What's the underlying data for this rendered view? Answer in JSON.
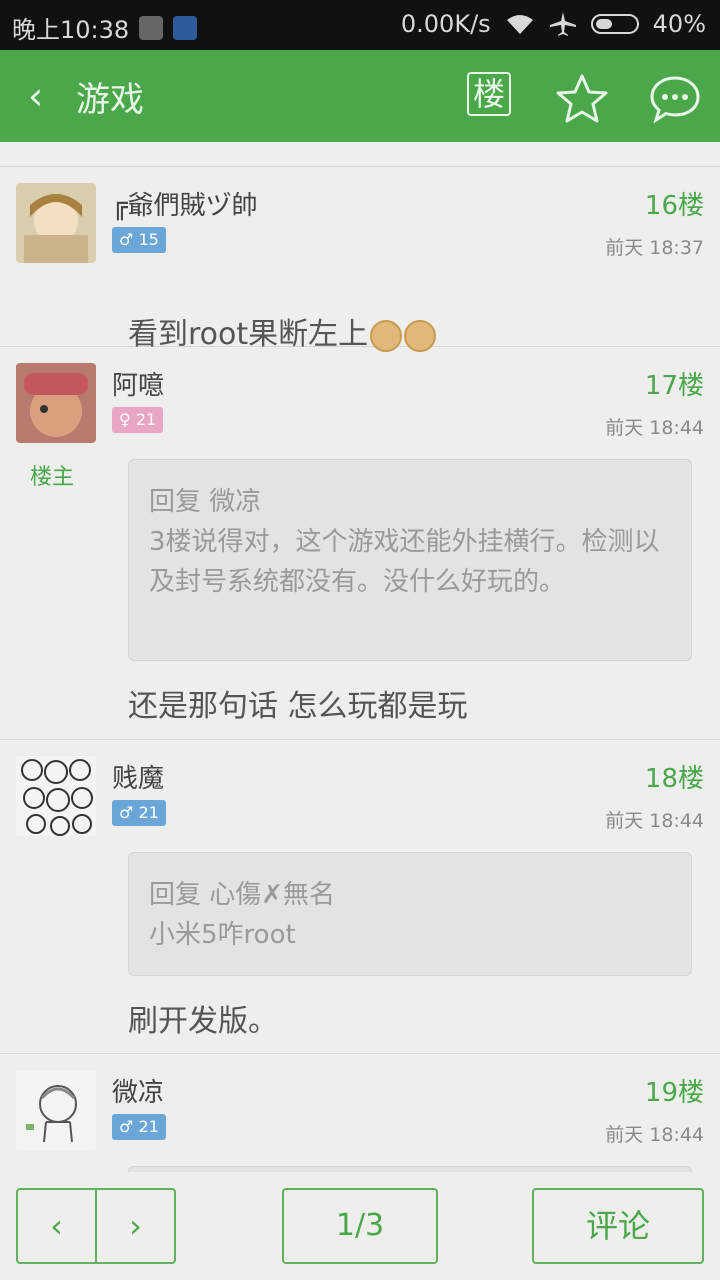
{
  "status_bar": {
    "time": "晚上10:38",
    "speed": "0.00K/s",
    "battery": "40%"
  },
  "header": {
    "back_icon": "chevron-left-icon",
    "title": "游戏",
    "floor_button": "楼",
    "favorite_icon": "star-icon",
    "comment_icon": "chat-bubble-icon"
  },
  "posts": [
    {
      "user": "╔爺們賊ヅ帥",
      "gender": "♂",
      "level": "15",
      "floor": "16楼",
      "time": "前天 18:37",
      "content": "看到root果断左上"
    },
    {
      "user": "阿噫",
      "gender": "♀",
      "level": "21",
      "floor": "17楼",
      "time": "前天 18:44",
      "host_label": "楼主",
      "quote_head": "回复 微凉",
      "quote_text": "3楼说得对，这个游戏还能外挂横行。检测以及封号系统都没有。没什么好玩的。",
      "content": "还是那句话 怎么玩都是玩"
    },
    {
      "user": "贱魔",
      "gender": "♂",
      "level": "21",
      "floor": "18楼",
      "time": "前天 18:44",
      "quote_head": "回复 心傷✗無名",
      "quote_text": "小米5咋root",
      "content": "刷开发版。"
    },
    {
      "user": "微凉",
      "gender": "♂",
      "level": "21",
      "floor": "19楼",
      "time": "前天 18:44"
    }
  ],
  "bottom_bar": {
    "prev": "‹",
    "next": "›",
    "page": "1/3",
    "comment": "评论"
  }
}
